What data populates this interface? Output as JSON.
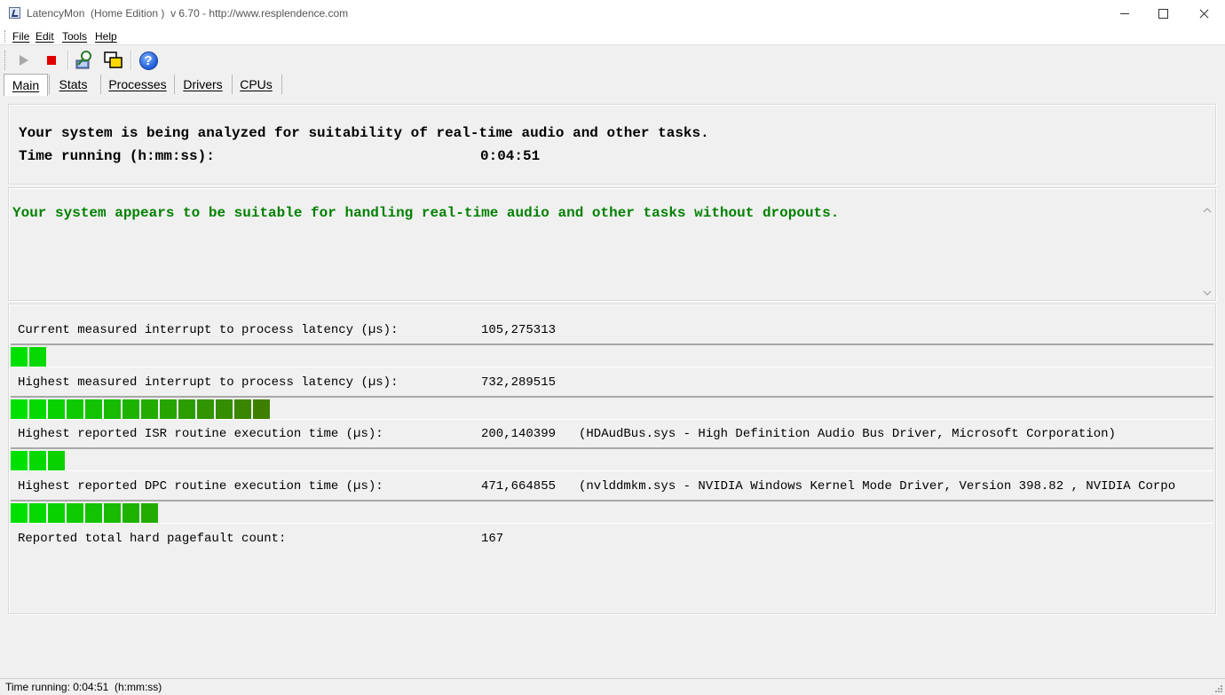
{
  "window": {
    "title": "LatencyMon  (Home Edition )  v 6.70 - http://www.resplendence.com"
  },
  "menu": {
    "items": [
      {
        "label": "File"
      },
      {
        "label": "Edit"
      },
      {
        "label": "Tools"
      },
      {
        "label": "Help"
      }
    ]
  },
  "toolbar": {
    "buttons": [
      {
        "icon": "play-icon"
      },
      {
        "icon": "stop-icon"
      },
      {
        "icon": "analyze-icon"
      },
      {
        "icon": "window-icon"
      },
      {
        "icon": "help-icon",
        "glyph": "?"
      }
    ]
  },
  "tabs": [
    {
      "label": "Main",
      "active": true
    },
    {
      "label": "Stats",
      "active": false
    },
    {
      "label": "Processes",
      "active": false
    },
    {
      "label": "Drivers",
      "active": false
    },
    {
      "label": "CPUs",
      "active": false
    }
  ],
  "header": {
    "line1": "Your system is being analyzed for suitability of real-time audio and other tasks.",
    "time_label": "Time running (h:mm:ss):",
    "time_value": "0:04:51"
  },
  "conclusion": {
    "text": "Your system appears to be suitable for handling real-time audio and other tasks without dropouts.",
    "color": "#008000"
  },
  "metrics": [
    {
      "label": "Current measured interrupt to process latency (µs):",
      "value": "105,275313",
      "desc": "",
      "segments": 2
    },
    {
      "label": "Highest measured interrupt to process latency (µs):",
      "value": "732,289515",
      "desc": "",
      "segments": 14
    },
    {
      "label": "Highest reported ISR routine execution time (µs):",
      "value": "200,140399",
      "desc": "(HDAudBus.sys - High Definition Audio Bus Driver, Microsoft Corporation)",
      "segments": 3
    },
    {
      "label": "Highest reported DPC routine execution time (µs):",
      "value": "471,664855",
      "desc": "(nvlddmkm.sys - NVIDIA Windows Kernel Mode Driver, Version 398.82 , NVIDIA Corpo",
      "segments": 8
    },
    {
      "label": "Reported total hard pagefault count:",
      "value": "167",
      "desc": ""
    }
  ],
  "colors": {
    "bar_start": "#00e000",
    "bar_end": "#3f7f00"
  },
  "statusbar": {
    "text": "Time running: 0:04:51  (h:mm:ss)"
  }
}
